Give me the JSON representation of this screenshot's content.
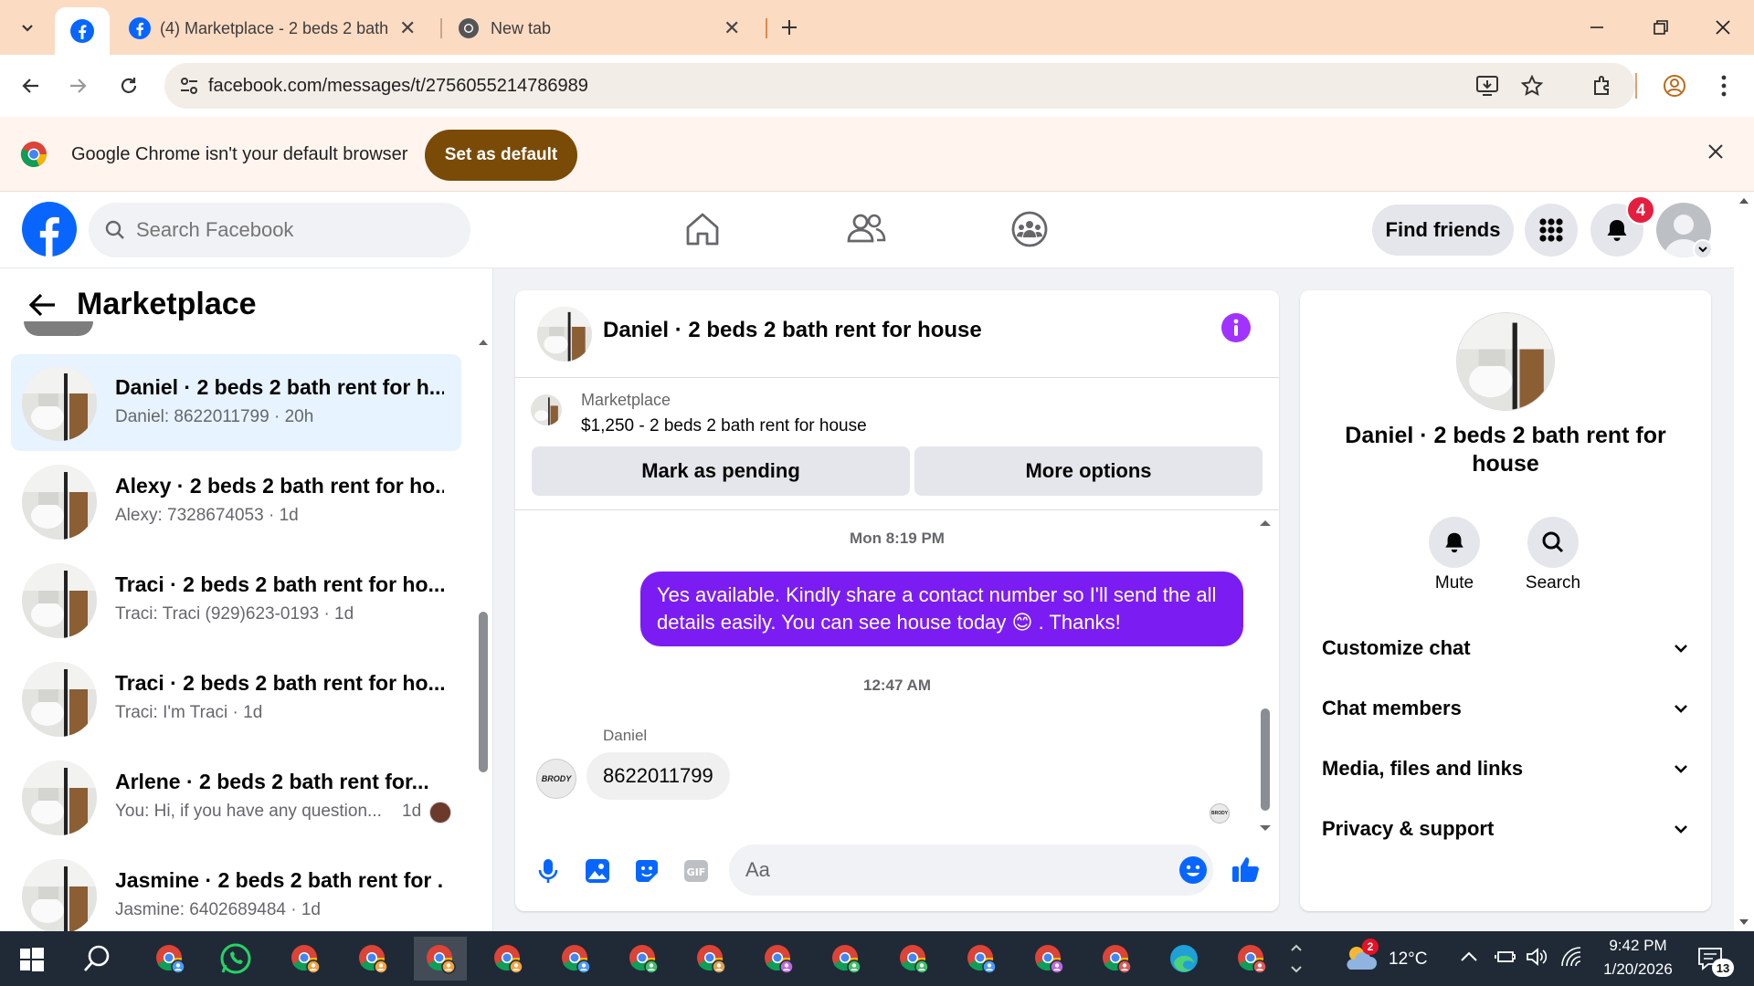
{
  "browser": {
    "tabs": [
      {
        "title": "(4) Marketplace - 2 beds 2 bath",
        "icon": "facebook-icon"
      },
      {
        "title": "New tab",
        "icon": "chrome-icon"
      }
    ],
    "url": "facebook.com/messages/t/2756055214786989",
    "infobar": {
      "text": "Google Chrome isn't your default browser",
      "button": "Set as default"
    }
  },
  "fb": {
    "search_placeholder": "Search Facebook",
    "find_friends": "Find friends",
    "notification_count": "4"
  },
  "sidebar": {
    "title": "Marketplace",
    "conversations": [
      {
        "name": "Daniel · 2 beds 2 bath rent for h...",
        "preview": "Daniel: 8622011799 · 20h",
        "selected": true
      },
      {
        "name": "Alexy · 2 beds 2 bath rent for ho...",
        "preview": "Alexy: 7328674053 · 1d"
      },
      {
        "name": "Traci · 2 beds 2 bath rent for ho...",
        "preview": "Traci: Traci (929)623-0193 · 1d"
      },
      {
        "name": "Traci · 2 beds 2 bath rent for ho...",
        "preview": "Traci: I'm Traci · 1d"
      },
      {
        "name": "Arlene · 2 beds 2 bath rent for...",
        "preview": "You: Hi, if you have any question...",
        "time": "1d"
      },
      {
        "name": "Jasmine · 2 beds 2 bath rent for ...",
        "preview": "Jasmine: 6402689484 · 1d"
      }
    ]
  },
  "chat": {
    "title": "Daniel · 2 beds 2 bath rent for house",
    "listing_label": "Marketplace",
    "listing_title": "$1,250 - 2 beds 2 bath rent for house",
    "mark_pending": "Mark as pending",
    "more_options": "More options",
    "messages": [
      {
        "type": "timestamp",
        "text": "Mon 8:19 PM"
      },
      {
        "type": "sent",
        "line1": "Yes available. Kindly share a contact number so I'll send the all",
        "line2_before": "details easily. You can see house today",
        "emoji": "😊",
        "line2_after": ". Thanks!"
      },
      {
        "type": "timestamp",
        "text": "12:47 AM"
      },
      {
        "type": "received",
        "sender": "Daniel",
        "text": "8622011799",
        "avatar_text": "BRODY"
      }
    ],
    "composer_placeholder": "Aa"
  },
  "info": {
    "name_line1": "Daniel · 2 beds 2 bath rent for",
    "name_line2": "house",
    "mute": "Mute",
    "search": "Search",
    "sections": [
      "Customize chat",
      "Chat members",
      "Media, files and links",
      "Privacy & support"
    ]
  },
  "taskbar": {
    "weather_temp": "12°C",
    "weather_badge": "2",
    "time": "9:42 PM",
    "date": "1/20/2026",
    "notif_count": "13"
  },
  "colors": {
    "fb_blue": "#0866ff",
    "sent_bubble": "#7b1df2",
    "tab_strip": "#fcdbc3",
    "set_default": "#7a4a07",
    "info_purple": "#a033ff"
  }
}
